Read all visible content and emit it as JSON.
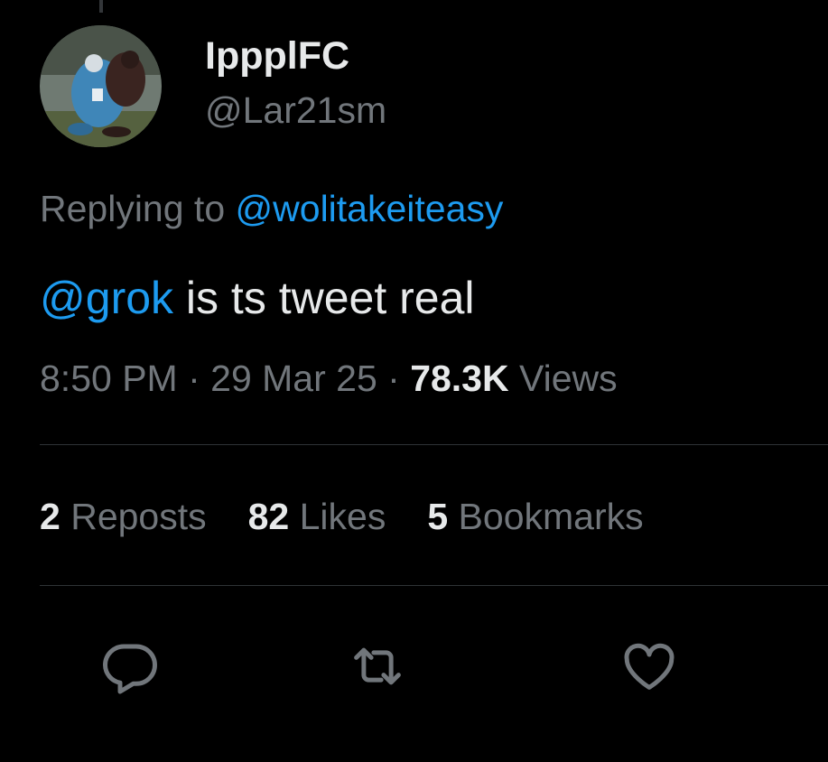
{
  "author": {
    "display_name": "IppplFC",
    "handle": "@Lar21sm"
  },
  "reply": {
    "prefix": "Replying to",
    "to_handle": "@wolitakeiteasy"
  },
  "tweet": {
    "mention": "@grok",
    "text": " is ts tweet real"
  },
  "meta": {
    "time": "8:50 PM",
    "separator": " · ",
    "date": "29 Mar 25",
    "views_count": "78.3K",
    "views_label": " Views"
  },
  "stats": [
    {
      "count": "2",
      "label": " Reposts"
    },
    {
      "count": "82",
      "label": " Likes"
    },
    {
      "count": "5",
      "label": " Bookmarks"
    }
  ],
  "actions": [
    {
      "icon": "reply-icon"
    },
    {
      "icon": "repost-icon"
    },
    {
      "icon": "like-icon"
    }
  ],
  "colors": {
    "background": "#000000",
    "text_primary": "#e7e9ea",
    "text_secondary": "#71767b",
    "accent": "#1d9bf0",
    "divider": "#2f3336"
  }
}
